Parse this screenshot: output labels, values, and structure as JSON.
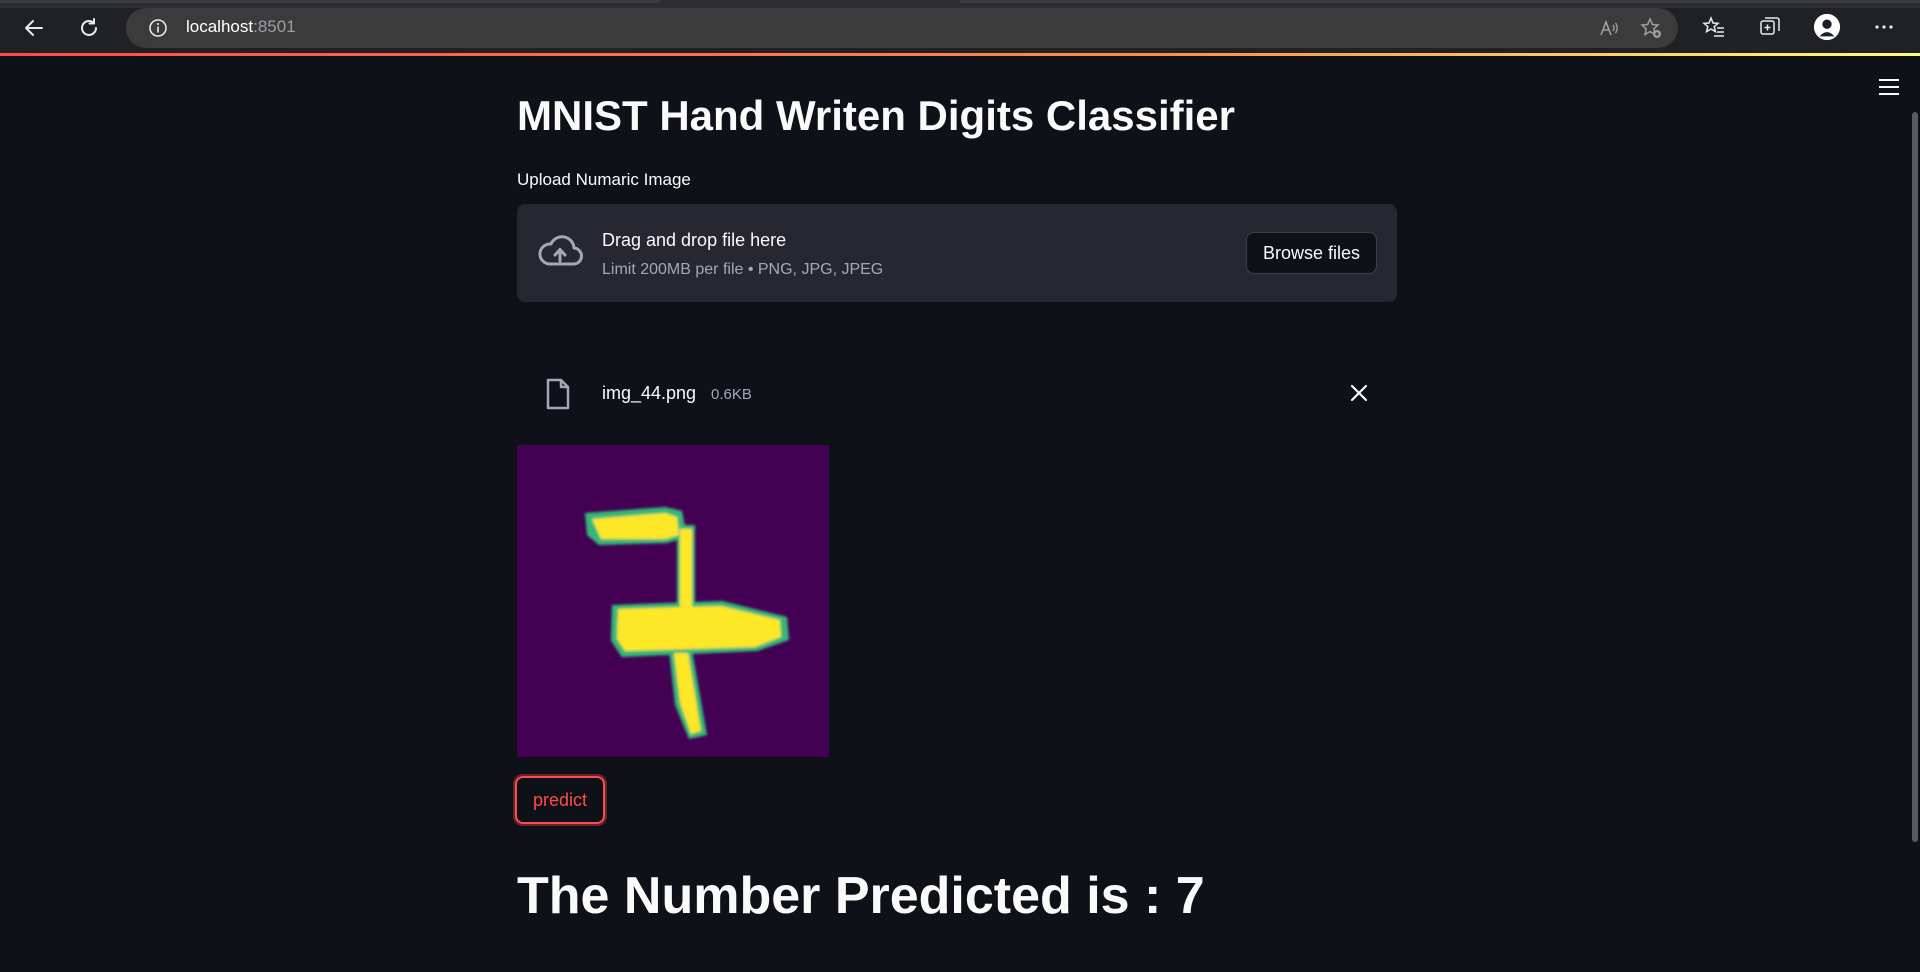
{
  "browser": {
    "url_host": "localhost",
    "url_port": ":8501",
    "icons": [
      "back-icon",
      "refresh-icon",
      "info-icon",
      "read-aloud-icon",
      "add-favorite-icon",
      "favorites-icon",
      "collections-icon",
      "profile-avatar",
      "more-icon"
    ]
  },
  "app": {
    "title": "MNIST Hand Writen Digits Classifier",
    "uploader": {
      "label": "Upload Numaric Image",
      "drop_text": "Drag and drop file here",
      "limit_text": "Limit 200MB per file • PNG, JPG, JPEG",
      "browse_label": "Browse files"
    },
    "uploaded_file": {
      "name": "img_44.png",
      "size": "0.6KB"
    },
    "predict_label": "predict",
    "result_text": "The Number Predicted is : 7"
  },
  "colors": {
    "background": "#0e1117",
    "dropzone": "#262730",
    "accent": "#ff4b4b",
    "image_bg": "#440154",
    "digit_fill": "#fde725",
    "digit_edge": "#35b779"
  }
}
